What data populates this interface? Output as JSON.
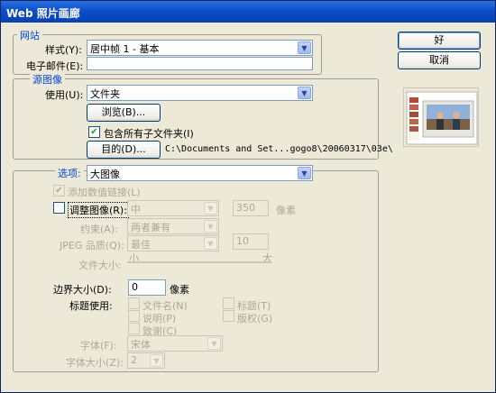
{
  "title": "Web 照片画廊",
  "buttons": {
    "ok": "好",
    "cancel": "取消"
  },
  "site": {
    "legend": "网站",
    "style_label": "样式(Y):",
    "style_value": "居中帧 1 - 基本",
    "email_label": "电子邮件(E):",
    "email_value": ""
  },
  "source": {
    "legend": "源图像",
    "use_label": "使用(U):",
    "use_value": "文件夹",
    "browse_label": "浏览(B)...",
    "include_subfolders_label": "包含所有子文件夹(I)",
    "include_subfolders_checked": true,
    "destination_label": "目的(D)...",
    "destination_path": "C:\\Documents and Set...gogo8\\20060317\\03e\\"
  },
  "options": {
    "label": "选项:",
    "value": "大图像",
    "add_width_height_label": "添加数值链接(L)",
    "resize_images_label": "调整图像(R):",
    "resize_size_value": "中",
    "resize_px_value": "350",
    "pixels_unit": "像素",
    "constrain_label": "约束(A):",
    "constrain_value": "两者兼有",
    "jpeg_quality_label": "JPEG 品质(Q):",
    "jpeg_quality_value": "最佳",
    "jpeg_quality_number": "10",
    "file_size_label": "文件大小:",
    "file_size_small": "小",
    "file_size_large": "大",
    "border_size_label": "边界大小(D):",
    "border_size_value": "0",
    "border_unit": "像素",
    "titles_use_label": "标题使用:",
    "filename_label": "文件名(N)",
    "title_label": "标题(T)",
    "caption_label": "说明(P)",
    "copyright_label": "版权(G)",
    "credits_label": "致谢(C)",
    "font_label": "字体(F):",
    "font_value": "宋体",
    "font_size_label": "字体大小(Z):",
    "font_size_value": "2"
  },
  "colors": {
    "title_bar": "#0a4fc9",
    "window": "#ece9d8",
    "legend_text": "#0046d5",
    "disabled_text": "#aca899"
  }
}
